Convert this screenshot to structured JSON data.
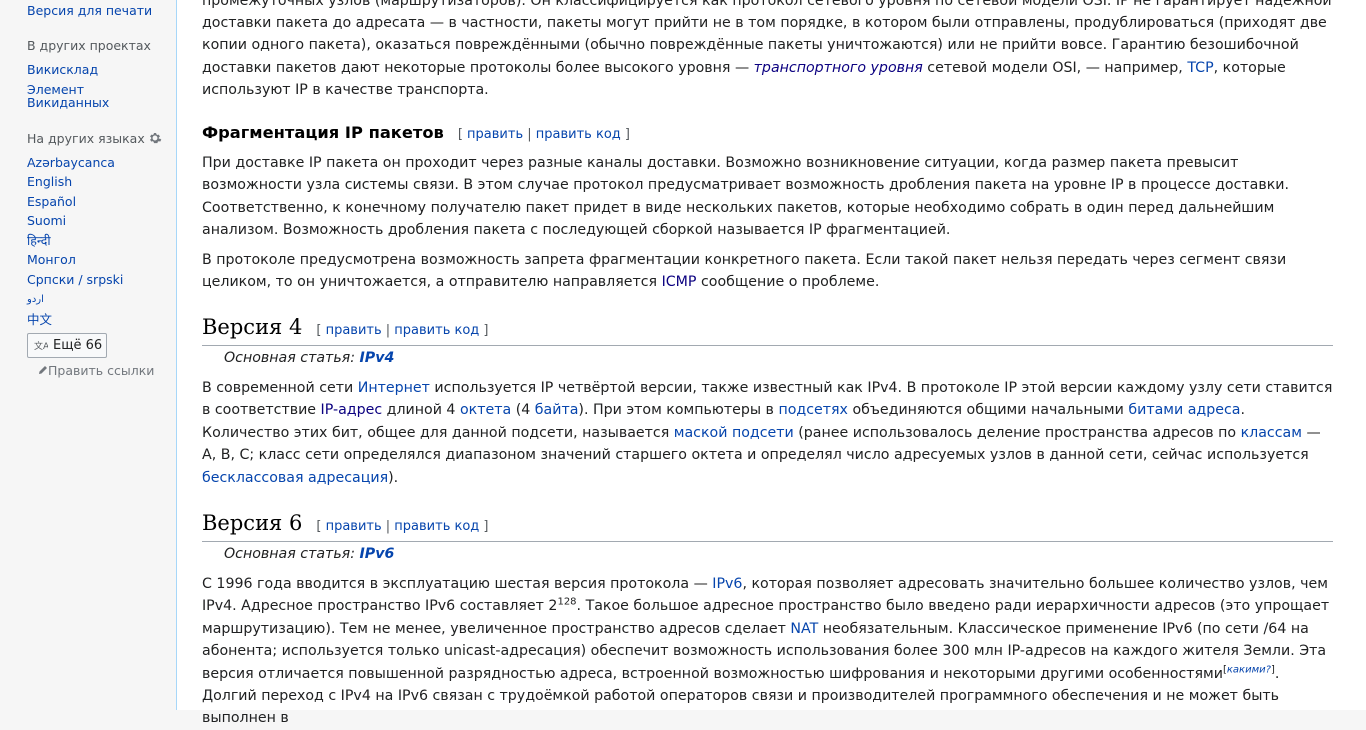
{
  "sidebar": {
    "print_version": "Версия для печати",
    "other_projects_heading": "В других проектах",
    "commons": "Викисклад",
    "wikidata_item": "Элемент Викиданных",
    "other_languages_heading": "На других языках",
    "languages": [
      "Azərbaycanca",
      "English",
      "Español",
      "Suomi",
      "हिन्दी",
      "Монгол",
      "Српски / srpski",
      "اردو",
      "中文"
    ],
    "more_languages_label": "Ещё 66",
    "edit_links": "Править ссылки"
  },
  "article": {
    "p_intro_frag": "промежуточных узлов (маршрутизаторов). Он классифицируется как протокол сетевого уровня по сетевой модели OSI. IP не гарантирует надёжной",
    "p_intro_1a": "доставки пакета до адресата — в частности, пакеты могут прийти не в том порядке, в котором были отправлены, продублироваться (приходят две",
    "p_intro_1b": "копии одного пакета), оказаться повреждёнными (обычно повреждённые пакеты уничтожаются) или не прийти вовсе. Гарантию безошибочной",
    "p_intro_1c": "доставки пакетов дают некоторые протоколы более высокого уровня — ",
    "p_intro_link_transport": "транспортного уровня",
    "p_intro_1d": " сетевой модели OSI, — например, ",
    "p_intro_link_tcp": "TCP",
    "p_intro_1e": ", которые",
    "p_intro_1f": "используют IP в качестве транспорта.",
    "frag_heading": "Фрагментация IP пакетов",
    "edit_label": "править",
    "edit_code_label": "править код",
    "frag_p1": "При доставке IP пакета он проходит через разные каналы доставки. Возможно возникновение ситуации, когда размер пакета превысит возможности узла системы связи. В этом случае протокол предусматривает возможность дробления пакета на уровне IP в процессе доставки. Соответственно, к конечному получателю пакет придет в виде нескольких пакетов, которые необходимо собрать в один перед дальнейшим анализом. Возможность дробления пакета с последующей сборкой называется IP фрагментацией.",
    "frag_p2a": "В протоколе предусмотрена возможность запрета фрагментации конкретного пакета. Если такой пакет нельзя передать через сегмент связи целиком, то он уничтожается, а отправителю направляется ",
    "frag_p2_link_icmp": "ICMP",
    "frag_p2b": " сообщение о проблеме.",
    "v4_heading": "Версия 4",
    "main_article_label": "Основная статья: ",
    "v4_main_link": "IPv4",
    "v4_p_1": "В современной сети ",
    "v4_link_internet": "Интернет",
    "v4_p_2": " используется IP четвёртой версии, также известный как IPv4. В протоколе IP этой версии каждому узлу сети ставится в соответствие ",
    "v4_link_ipaddr": "IP-адрес",
    "v4_p_3": " длиной 4 ",
    "v4_link_octet": "октета",
    "v4_p_4": " (4 ",
    "v4_link_byte": "байта",
    "v4_p_5": "). При этом компьютеры в ",
    "v4_link_subnets": "подсетях",
    "v4_p_6": " объединяются общими начальными ",
    "v4_link_bits": "битами адреса",
    "v4_p_7": ". Количество этих бит, общее для данной подсети, называется ",
    "v4_link_mask": "маской подсети",
    "v4_p_8": " (ранее использовалось деление пространства адресов по ",
    "v4_link_classes": "классам",
    "v4_p_9": " — A, B, C; класс сети определялся диапазоном значений старшего октета и определял число адресуемых узлов в данной сети, сейчас используется ",
    "v4_link_classless": "бесклассовая адресация",
    "v4_p_10": ").",
    "v6_heading": "Версия 6",
    "v6_main_link": "IPv6",
    "v6_p_1": "С 1996 года вводится в эксплуатацию шестая версия протокола — ",
    "v6_link_ipv6": "IPv6",
    "v6_p_2": ", которая позволяет адресовать значительно большее количество узлов, чем IPv4. Адресное пространство IPv6 составляет 2",
    "v6_sup_exp": "128",
    "v6_p_3": ". Такое большое адресное пространство было введено ради иерархичности адресов (это упрощает маршрутизацию). Тем не менее, увеличенное пространство адресов сделает ",
    "v6_link_nat": "NAT",
    "v6_p_4": " необязательным. Классическое применение IPv6 (по сети /64 на абонента; используется только unicast-адресация) обеспечит возможность использования более 300 млн IP-адресов на каждого жителя Земли. Эта версия отличается повышенной разрядностью адреса, встроенной возможностью шифрования и некоторыми другими особенностями",
    "v6_note_which": "какими?",
    "v6_p_5": ". Долгий переход с IPv4 на IPv6 связан с трудоёмкой работой операторов связи и производителей программного обеспечения и не может быть выполнен в"
  }
}
